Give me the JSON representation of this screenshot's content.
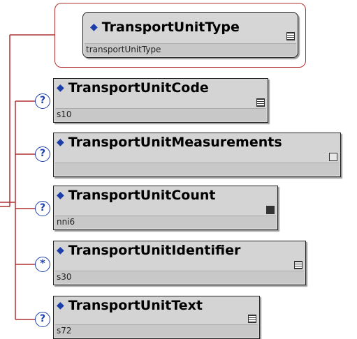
{
  "group": {
    "root": {
      "name": "TransportUnitType",
      "type": "transportUnitType",
      "icon": "list-lines-icon"
    }
  },
  "elements": [
    {
      "name": "TransportUnitCode",
      "type": "s10",
      "occurrence": "?",
      "icon": "list-lines-icon"
    },
    {
      "name": "TransportUnitMeasurements",
      "type": "",
      "occurrence": "?",
      "icon": "complex-type-icon"
    },
    {
      "name": "TransportUnitCount",
      "type": "nni6",
      "occurrence": "?",
      "icon": "dark-type-icon"
    },
    {
      "name": "TransportUnitIdentifier",
      "type": "s30",
      "occurrence": "*",
      "icon": "list-lines-icon"
    },
    {
      "name": "TransportUnitText",
      "type": "s72",
      "occurrence": "?",
      "icon": "list-lines-icon"
    }
  ],
  "colors": {
    "connector": "#b03030",
    "occurrence": "#1d3ea8",
    "diamond": "#1d3ea8",
    "box": "#d4d4d4"
  }
}
